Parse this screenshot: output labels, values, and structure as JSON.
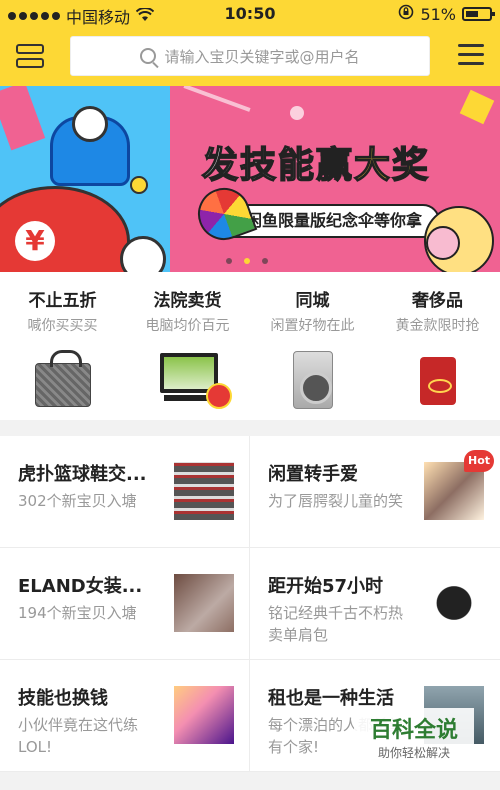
{
  "status_bar": {
    "carrier": "中国移动",
    "time": "10:50",
    "battery": "51%"
  },
  "search": {
    "placeholder": "请输入宝贝关键字或@用户名"
  },
  "banner": {
    "title_part1": "发技能",
    "title_part2": "赢大奖",
    "subtitle": "闲鱼限量版纪念伞等你拿",
    "left_symbol": "¥"
  },
  "categories": [
    {
      "title": "不止五折",
      "subtitle": "喊你买买买"
    },
    {
      "title": "法院卖货",
      "subtitle": "电脑均价百元"
    },
    {
      "title": "同城",
      "subtitle": "闲置好物在此"
    },
    {
      "title": "奢侈品",
      "subtitle": "黄金款限时抢"
    }
  ],
  "cells": [
    {
      "title": "虎扑篮球鞋交...",
      "subtitle": "302个新宝贝入塘"
    },
    {
      "title": "闲置转手爱",
      "subtitle": "为了唇腭裂儿童的笑",
      "badge": "Hot"
    },
    {
      "title": "ELAND女装...",
      "subtitle": "194个新宝贝入塘"
    },
    {
      "title": "距开始57小时",
      "subtitle": "铭记经典千古不朽热卖单肩包"
    },
    {
      "title": "技能也换钱",
      "subtitle": "小伙伴竟在这代练LOL!"
    },
    {
      "title": "租也是一种生活",
      "subtitle": "每个漂泊的人都希望有个家!"
    }
  ],
  "watermark": {
    "title": "百科全说",
    "subtitle": "助你轻松解决"
  }
}
